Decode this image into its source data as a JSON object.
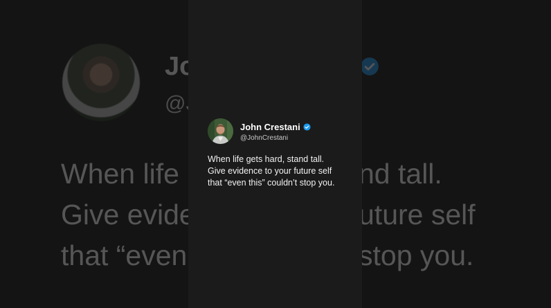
{
  "tweet": {
    "author_name": "John Crestani",
    "handle": "@JohnCrestani",
    "lines": [
      "When life gets hard, stand tall.",
      "Give evidence to your future self",
      "that “even this” couldn’t stop you."
    ],
    "verified_icon": "verified-badge-icon",
    "avatar_icon": "profile-photo"
  },
  "background": {
    "name_fragment": "Jo",
    "handle_fragment": "@J",
    "lines": [
      "When life g",
      "Give evide",
      "that “even"
    ],
    "lines_right": [
      "nd tall.",
      "uture self",
      "stop you."
    ]
  },
  "colors": {
    "page_bg": "#000000",
    "panel_bg": "#1b1b1b",
    "text": "#f2f2f2",
    "verified_blue": "#1d9bf0"
  }
}
